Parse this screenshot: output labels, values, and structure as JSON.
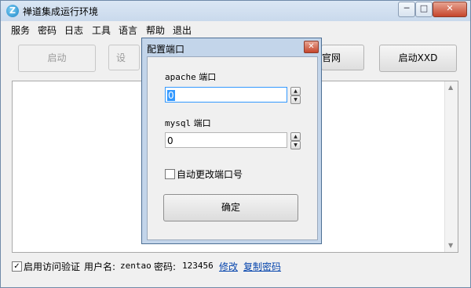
{
  "window": {
    "title": "禅道集成运行环境",
    "app_icon_letter": "Z",
    "controls": {
      "minimize": "─",
      "maximize": "□",
      "close": "✕"
    }
  },
  "menu": [
    "服务",
    "密码",
    "日志",
    "工具",
    "语言",
    "帮助",
    "退出"
  ],
  "toolbar": {
    "start_label": "启动",
    "second_partial_label": "设",
    "visit_site_partial_label": "官网",
    "start_xxd_label": "启动XXD"
  },
  "log": {
    "text": ""
  },
  "footer": {
    "enable_auth_checked": true,
    "enable_auth_label": "启用访问验证",
    "username_label": "用户名:",
    "username_value": "zentao",
    "password_label": "密码:",
    "password_value": "123456",
    "modify_link": "修改",
    "copy_password_link": "复制密码"
  },
  "dialog": {
    "title": "配置端口",
    "apache_label_prefix": "apache",
    "apache_label_suffix": "端口",
    "apache_value": "0",
    "mysql_label_prefix": "mysql",
    "mysql_label_suffix": "端口",
    "mysql_value": "0",
    "auto_change_checked": false,
    "auto_change_label": "自动更改端口号",
    "ok_label": "确定"
  }
}
